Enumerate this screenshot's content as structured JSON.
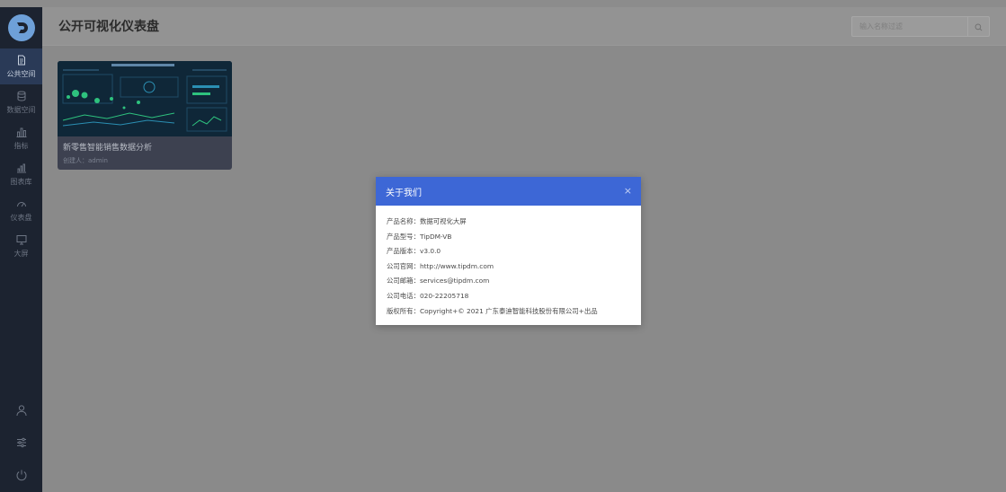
{
  "sidebar": {
    "items": [
      {
        "label": "公共空间",
        "icon": "document-icon",
        "active": true
      },
      {
        "label": "数据空间",
        "icon": "database-icon",
        "active": false
      },
      {
        "label": "指标",
        "icon": "bar-chart-icon",
        "active": false
      },
      {
        "label": "图表库",
        "icon": "chart-library-icon",
        "active": false
      },
      {
        "label": "仪表盘",
        "icon": "gauge-icon",
        "active": false
      },
      {
        "label": "大屏",
        "icon": "monitor-icon",
        "active": false
      }
    ],
    "bottom_icons": [
      "user-icon",
      "settings-sliders-icon",
      "power-icon"
    ]
  },
  "header": {
    "title": "公开可视化仪表盘",
    "search_placeholder": "输入名称过滤"
  },
  "card": {
    "title": "新零售智能销售数据分析",
    "creator": "创建人：admin"
  },
  "modal": {
    "title": "关于我们",
    "close": "×",
    "rows": [
      "产品名称：数据可视化大屏",
      "产品型号：TipDM-VB",
      "产品版本：v3.0.0",
      "公司官网：http://www.tipdm.com",
      "公司邮箱：services@tipdm.com",
      "公司电话：020-22205718",
      "版权所有：Copyright+© 2021 广东泰迪智能科技股份有限公司+出品"
    ]
  },
  "colors": {
    "sidebar_bg": "#1c2330",
    "modal_header": "#3d67d6",
    "overlay": "#8c8c8c"
  }
}
